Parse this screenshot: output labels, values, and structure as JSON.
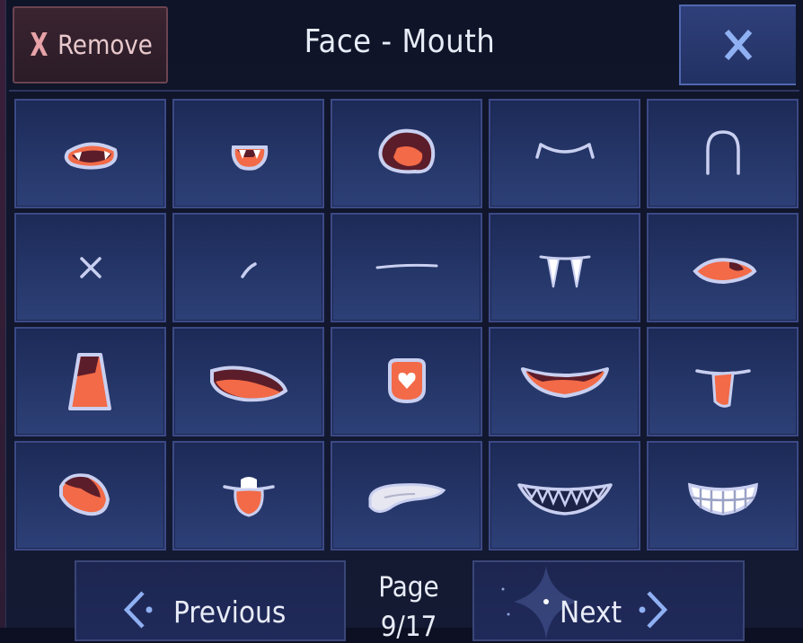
{
  "header": {
    "remove_x": "X",
    "remove_label": "Remove",
    "title": "Face - Mouth",
    "close_icon": "close-x-icon"
  },
  "grid": {
    "items": [
      {
        "icon": "fanged-open-mouth-icon"
      },
      {
        "icon": "small-fanged-mouth-icon"
      },
      {
        "icon": "large-open-tongue-mouth-icon"
      },
      {
        "icon": "cat-smile-mouth-icon"
      },
      {
        "icon": "arch-mouth-icon"
      },
      {
        "icon": "x-mouth-icon"
      },
      {
        "icon": "small-slash-mouth-icon"
      },
      {
        "icon": "flat-line-mouth-icon"
      },
      {
        "icon": "vampire-fangs-icon"
      },
      {
        "icon": "side-tongue-mouth-icon"
      },
      {
        "icon": "trapezoid-open-mouth-icon"
      },
      {
        "icon": "wide-open-mouth-icon"
      },
      {
        "icon": "heart-mouth-icon"
      },
      {
        "icon": "wide-smile-tongue-icon"
      },
      {
        "icon": "tongue-out-mouth-icon"
      },
      {
        "icon": "tilted-open-mouth-icon"
      },
      {
        "icon": "drooling-mouth-icon"
      },
      {
        "icon": "pale-tongue-mouth-icon"
      },
      {
        "icon": "sharp-grin-icon"
      },
      {
        "icon": "grit-teeth-grin-icon"
      }
    ]
  },
  "footer": {
    "previous_label": "Previous",
    "page_label": "Page",
    "page_value": "9/17",
    "next_label": "Next"
  },
  "colors": {
    "cell_bg": "#2a3b72",
    "cell_border": "#3c4a86",
    "mouth_fill": "#f26a47",
    "mouth_dark": "#5c1d2a",
    "outline": "#c9cff0",
    "remove_bg": "#3a2430",
    "close_bg": "#2f3f7a"
  }
}
